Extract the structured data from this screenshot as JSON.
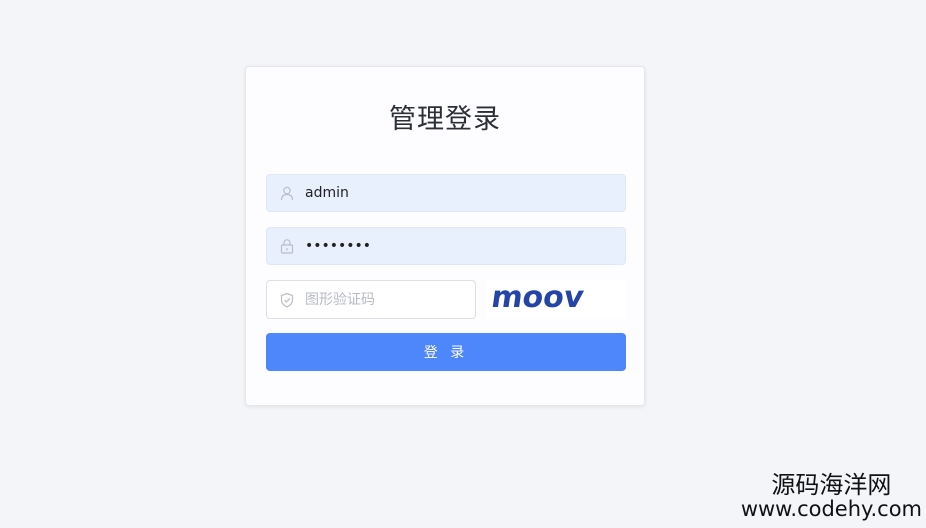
{
  "login": {
    "title": "管理登录",
    "username": {
      "value": "admin",
      "icon": "user-icon"
    },
    "password": {
      "value": "12345678",
      "icon": "lock-icon"
    },
    "captcha": {
      "placeholder": "图形验证码",
      "icon": "shield-check-icon",
      "image_text": "moov"
    },
    "submit_label": "登 录"
  },
  "colors": {
    "page_background": "#f4f5f9",
    "autofill_background": "#e8f0fe",
    "primary": "#4e86fb",
    "captcha_text": "#2444a8"
  },
  "watermark": {
    "line1": "源码海洋网",
    "line2": "www.codehy.com"
  }
}
